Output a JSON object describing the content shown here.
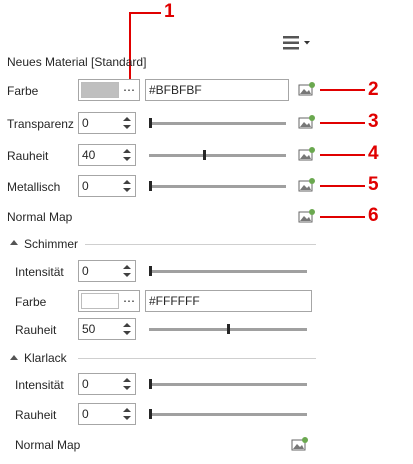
{
  "title": "Neues Material [Standard]",
  "menu_icon": "hamburger-menu-icon",
  "main": {
    "farbe": {
      "label": "Farbe",
      "swatch_color": "#BFBFBF",
      "hex": "#BFBFBF",
      "more": "⋯"
    },
    "transparenz": {
      "label": "Transparenz",
      "value": "0",
      "slider_fraction": 0.0
    },
    "rauheit": {
      "label": "Rauheit",
      "value": "40",
      "slider_fraction": 0.4
    },
    "metallisch": {
      "label": "Metallisch",
      "value": "0",
      "slider_fraction": 0.0
    },
    "normal_map": {
      "label": "Normal Map"
    }
  },
  "schimmer": {
    "title": "Schimmer",
    "intensitaet": {
      "label": "Intensität",
      "value": "0",
      "slider_fraction": 0.0
    },
    "farbe": {
      "label": "Farbe",
      "swatch_color": "#FFFFFF",
      "hex": "#FFFFFF",
      "more": "⋯"
    },
    "rauheit": {
      "label": "Rauheit",
      "value": "50",
      "slider_fraction": 0.5
    }
  },
  "klarlack": {
    "title": "Klarlack",
    "intensitaet": {
      "label": "Intensität",
      "value": "0",
      "slider_fraction": 0.0
    },
    "rauheit": {
      "label": "Rauheit",
      "value": "0",
      "slider_fraction": 0.0
    },
    "normal_map": {
      "label": "Normal Map"
    }
  },
  "callouts": [
    "1",
    "2",
    "3",
    "4",
    "5",
    "6"
  ],
  "colors": {
    "callout": "#E00000",
    "accent_icon": "#6aa84f"
  }
}
